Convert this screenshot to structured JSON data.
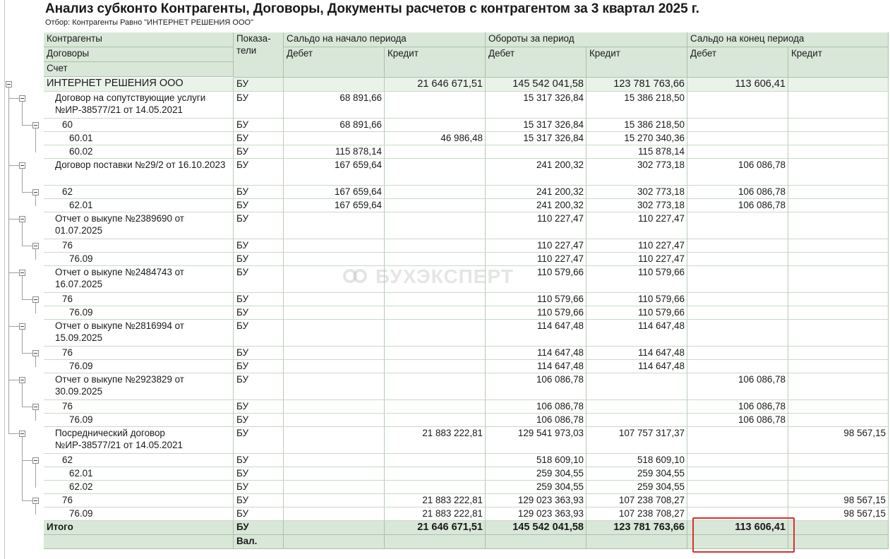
{
  "report": {
    "title": "Анализ субконто Контрагенты, Договоры, Документы расчетов с контрагентом за 3 квартал 2025 г.",
    "filter": "Отбор: Контрагенты Равно \"ИНТЕРНЕТ РЕШЕНИЯ ООО\""
  },
  "headers": {
    "col1": [
      "Контрагенты",
      "Договоры",
      "Счет"
    ],
    "indicators": [
      "Показа-",
      "тели"
    ],
    "opening": "Сальдо на начало периода",
    "turnover": "Обороты за период",
    "closing": "Сальдо на конец периода",
    "debit": "Дебет",
    "credit": "Кредит"
  },
  "watermark": "БУХЭКСПЕРТ",
  "rows": [
    {
      "label": "ИНТЕРНЕТ РЕШЕНИЯ ООО",
      "ind": "БУ",
      "od": "",
      "oc": "21 646 671,51",
      "td": "145 542 041,58",
      "tc": "123 781 763,66",
      "cd": "113 606,41",
      "cc": ""
    },
    {
      "label": "Договор на сопутствующие услуги №ИР-38577/21 от 14.05.2021",
      "ind": "БУ",
      "od": "68 891,66",
      "oc": "",
      "td": "15 317 326,84",
      "tc": "15 386 218,50",
      "cd": "",
      "cc": ""
    },
    {
      "label": "60",
      "ind": "БУ",
      "od": "68 891,66",
      "oc": "",
      "td": "15 317 326,84",
      "tc": "15 386 218,50",
      "cd": "",
      "cc": ""
    },
    {
      "label": "60.01",
      "ind": "БУ",
      "od": "",
      "oc": "46 986,48",
      "td": "15 317 326,84",
      "tc": "15 270 340,36",
      "cd": "",
      "cc": ""
    },
    {
      "label": "60.02",
      "ind": "БУ",
      "od": "115 878,14",
      "oc": "",
      "td": "",
      "tc": "115 878,14",
      "cd": "",
      "cc": ""
    },
    {
      "label": "Договор поставки №29/2 от 16.10.2023",
      "ind": "БУ",
      "od": "167 659,64",
      "oc": "",
      "td": "241 200,32",
      "tc": "302 773,18",
      "cd": "106 086,78",
      "cc": ""
    },
    {
      "label": "62",
      "ind": "БУ",
      "od": "167 659,64",
      "oc": "",
      "td": "241 200,32",
      "tc": "302 773,18",
      "cd": "106 086,78",
      "cc": ""
    },
    {
      "label": "62.01",
      "ind": "БУ",
      "od": "167 659,64",
      "oc": "",
      "td": "241 200,32",
      "tc": "302 773,18",
      "cd": "106 086,78",
      "cc": ""
    },
    {
      "label": "Отчет о выкупе №2389690 от 01.07.2025",
      "ind": "БУ",
      "od": "",
      "oc": "",
      "td": "110 227,47",
      "tc": "110 227,47",
      "cd": "",
      "cc": ""
    },
    {
      "label": "76",
      "ind": "БУ",
      "od": "",
      "oc": "",
      "td": "110 227,47",
      "tc": "110 227,47",
      "cd": "",
      "cc": ""
    },
    {
      "label": "76.09",
      "ind": "БУ",
      "od": "",
      "oc": "",
      "td": "110 227,47",
      "tc": "110 227,47",
      "cd": "",
      "cc": ""
    },
    {
      "label": "Отчет о выкупе №2484743 от 16.07.2025",
      "ind": "БУ",
      "od": "",
      "oc": "",
      "td": "110 579,66",
      "tc": "110 579,66",
      "cd": "",
      "cc": ""
    },
    {
      "label": "76",
      "ind": "БУ",
      "od": "",
      "oc": "",
      "td": "110 579,66",
      "tc": "110 579,66",
      "cd": "",
      "cc": ""
    },
    {
      "label": "76.09",
      "ind": "БУ",
      "od": "",
      "oc": "",
      "td": "110 579,66",
      "tc": "110 579,66",
      "cd": "",
      "cc": ""
    },
    {
      "label": "Отчет о выкупе №2816994 от 15.09.2025",
      "ind": "БУ",
      "od": "",
      "oc": "",
      "td": "114 647,48",
      "tc": "114 647,48",
      "cd": "",
      "cc": ""
    },
    {
      "label": "76",
      "ind": "БУ",
      "od": "",
      "oc": "",
      "td": "114 647,48",
      "tc": "114 647,48",
      "cd": "",
      "cc": ""
    },
    {
      "label": "76.09",
      "ind": "БУ",
      "od": "",
      "oc": "",
      "td": "114 647,48",
      "tc": "114 647,48",
      "cd": "",
      "cc": ""
    },
    {
      "label": "Отчет о выкупе №2923829 от 30.09.2025",
      "ind": "БУ",
      "od": "",
      "oc": "",
      "td": "106 086,78",
      "tc": "",
      "cd": "106 086,78",
      "cc": ""
    },
    {
      "label": "76",
      "ind": "БУ",
      "od": "",
      "oc": "",
      "td": "106 086,78",
      "tc": "",
      "cd": "106 086,78",
      "cc": ""
    },
    {
      "label": "76.09",
      "ind": "БУ",
      "od": "",
      "oc": "",
      "td": "106 086,78",
      "tc": "",
      "cd": "106 086,78",
      "cc": ""
    },
    {
      "label": "Посреднический договор №ИР-38577/21 от 14.05.2021",
      "ind": "БУ",
      "od": "",
      "oc": "21 883 222,81",
      "td": "129 541 973,03",
      "tc": "107 757 317,37",
      "cd": "",
      "cc": "98 567,15"
    },
    {
      "label": "62",
      "ind": "БУ",
      "od": "",
      "oc": "",
      "td": "518 609,10",
      "tc": "518 609,10",
      "cd": "",
      "cc": ""
    },
    {
      "label": "62.01",
      "ind": "БУ",
      "od": "",
      "oc": "",
      "td": "259 304,55",
      "tc": "259 304,55",
      "cd": "",
      "cc": ""
    },
    {
      "label": "62.02",
      "ind": "БУ",
      "od": "",
      "oc": "",
      "td": "259 304,55",
      "tc": "259 304,55",
      "cd": "",
      "cc": ""
    },
    {
      "label": "76",
      "ind": "БУ",
      "od": "",
      "oc": "21 883 222,81",
      "td": "129 023 363,93",
      "tc": "107 238 708,27",
      "cd": "",
      "cc": "98 567,15"
    },
    {
      "label": "76.09",
      "ind": "БУ",
      "od": "",
      "oc": "21 883 222,81",
      "td": "129 023 363,93",
      "tc": "107 238 708,27",
      "cd": "",
      "cc": "98 567,15"
    }
  ],
  "total": {
    "label": "Итого",
    "ind1": "БУ",
    "ind2": "Вал.",
    "od": "",
    "oc": "21 646 671,51",
    "td": "145 542 041,58",
    "tc": "123 781 763,66",
    "cd": "113 606,41",
    "cc": ""
  }
}
